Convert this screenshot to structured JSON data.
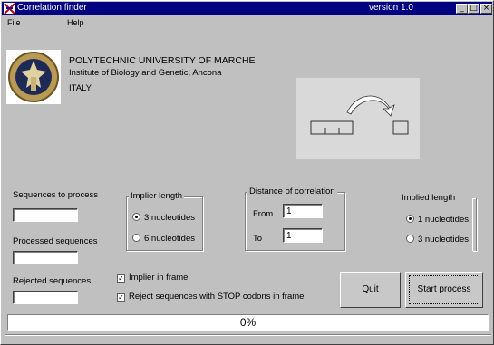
{
  "window": {
    "title": "Correlation finder",
    "version": "version 1.0",
    "min_glyph": "_",
    "max_glyph": "□",
    "close_glyph": "×"
  },
  "menu": {
    "file": "File",
    "help": "Help"
  },
  "header": {
    "university": "POLYTECHNIC UNIVERSITY OF MARCHE",
    "institute": "Institute of Biology and Genetic, Ancona",
    "country": "ITALY"
  },
  "left": {
    "sequences_to_process_label": "Sequences to process",
    "sequences_to_process_value": "",
    "processed_sequences_label": "Processed sequences",
    "processed_sequences_value": "",
    "rejected_sequences_label": "Rejected sequences",
    "rejected_sequences_value": ""
  },
  "implier_length": {
    "title": "Implier length",
    "options": [
      "3 nucleotides",
      "6 nucleotides"
    ],
    "selected": "3 nucleotides"
  },
  "distance": {
    "title": "Distance of correlation",
    "from_label": "From",
    "from_value": "1",
    "to_label": "To",
    "to_value": "1"
  },
  "implied_length": {
    "title": "Implied length",
    "options": [
      "1 nucleotides",
      "3 nucleotides"
    ],
    "selected": "1 nucleotides"
  },
  "checks": {
    "implier_in_frame": "Implier in frame",
    "implier_in_frame_checked": true,
    "reject_stop": "Reject sequences with STOP codons in frame",
    "reject_stop_checked": true
  },
  "buttons": {
    "quit": "Quit",
    "start": "Start process"
  },
  "progress": {
    "percent": 0,
    "text": "0%"
  },
  "colors": {
    "titlebar": "#000080",
    "face": "#c0c0c0",
    "panel": "#d9d9d9"
  }
}
